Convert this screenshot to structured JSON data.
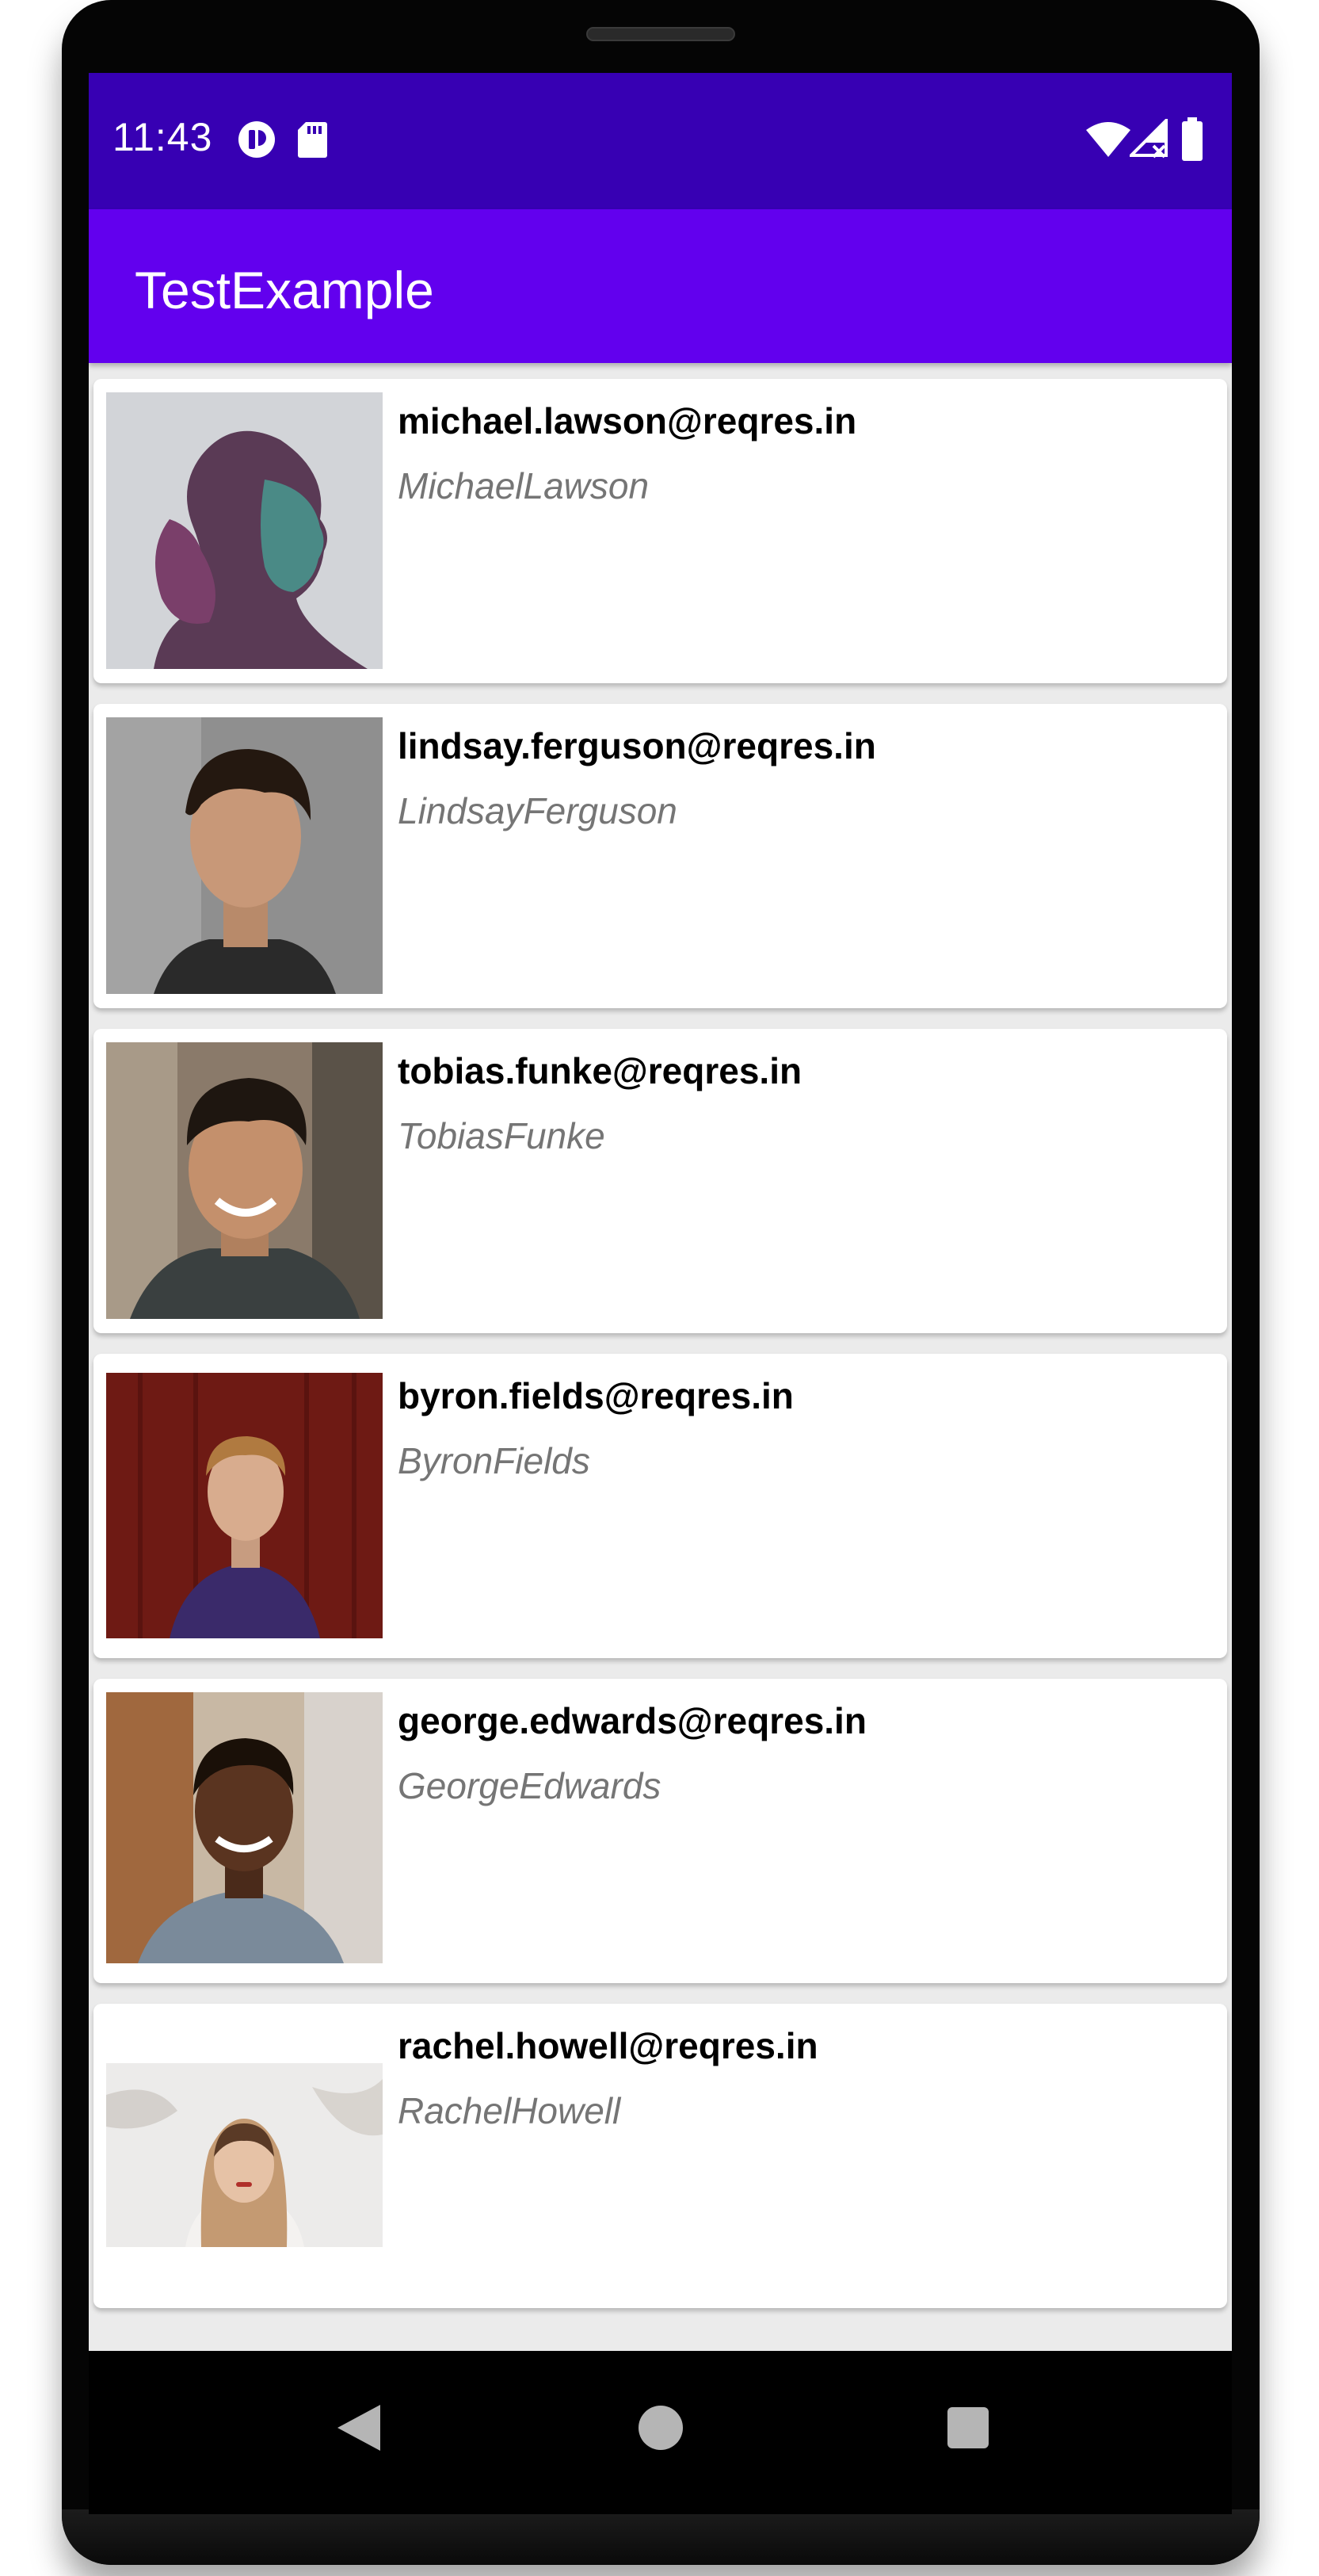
{
  "status_bar": {
    "time": "11:43",
    "left_icons": [
      "app-notification-icon",
      "sd-card-icon"
    ],
    "right_icons": [
      "wifi-icon",
      "signal-icon",
      "battery-icon"
    ],
    "color": "#3700b3"
  },
  "app_bar": {
    "title": "TestExample",
    "color": "#6200ee"
  },
  "users": [
    {
      "email": "michael.lawson@reqres.in",
      "name": "MichaelLawson"
    },
    {
      "email": "lindsay.ferguson@reqres.in",
      "name": "LindsayFerguson"
    },
    {
      "email": "tobias.funke@reqres.in",
      "name": "TobiasFunke"
    },
    {
      "email": "byron.fields@reqres.in",
      "name": "ByronFields"
    },
    {
      "email": "george.edwards@reqres.in",
      "name": "GeorgeEdwards"
    },
    {
      "email": "rachel.howell@reqres.in",
      "name": "RachelHowell"
    }
  ],
  "nav_bar": {
    "buttons": [
      "back-icon",
      "home-icon",
      "recents-icon"
    ]
  }
}
